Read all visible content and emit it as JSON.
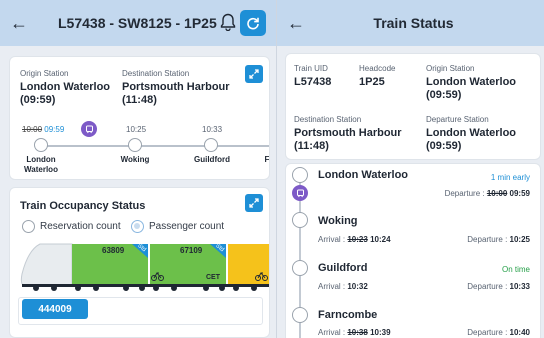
{
  "left": {
    "header": {
      "title": "L57438 - SW8125 - 1P25"
    },
    "route_card": {
      "origin_label": "Origin Station",
      "origin_value": "London Waterloo\n(09:59)",
      "dest_label": "Destination Station",
      "dest_value": "Portsmouth Harbour\n(11:48)",
      "stops": [
        {
          "name": "London\nWaterloo",
          "time_sched": "10:00",
          "time_actual": "09:59"
        },
        {
          "name": "Woking",
          "time": "10:25"
        },
        {
          "name": "Guildford",
          "time": "10:33"
        },
        {
          "name": "F"
        }
      ]
    },
    "occupancy": {
      "title": "Train Occupancy Status",
      "option_reservation": "Reservation count",
      "option_passenger": "Passenger count",
      "cars": [
        {
          "number": "63809",
          "tag": "Std"
        },
        {
          "number": "67109",
          "tag": "Std",
          "label": "CET"
        }
      ],
      "unit_button": "444009"
    }
  },
  "right": {
    "header": {
      "title": "Train Status"
    },
    "info": {
      "uid_label": "Train UID",
      "uid_value": "L57438",
      "headcode_label": "Headcode",
      "headcode_value": "1P25",
      "origin_label": "Origin Station",
      "origin_value": "London Waterloo\n(09:59)",
      "dest_label": "Destination Station",
      "dest_value": "Portsmouth Harbour\n(11:48)",
      "dep_label": "Departure Station",
      "dep_value": "London Waterloo\n(09:59)"
    },
    "timeline": [
      {
        "name": "London Waterloo",
        "status": "1 min early",
        "dep_label": "Departure :",
        "dep_sched": "10:00",
        "dep_actual": "09:59"
      },
      {
        "name": "Woking",
        "arr_label": "Arrival :",
        "arr_sched": "10:23",
        "arr_actual": "10:24",
        "dep_label": "Departure :",
        "dep": "10:25"
      },
      {
        "name": "Guildford",
        "status": "On time",
        "arr_label": "Arrival :",
        "arr": "10:32",
        "dep_label": "Departure :",
        "dep": "10:33"
      },
      {
        "name": "Farncombe",
        "arr_label": "Arrival :",
        "arr_sched": "10:38",
        "arr_actual": "10:39",
        "dep_label": "Departure :",
        "dep": "10:40"
      }
    ]
  }
}
